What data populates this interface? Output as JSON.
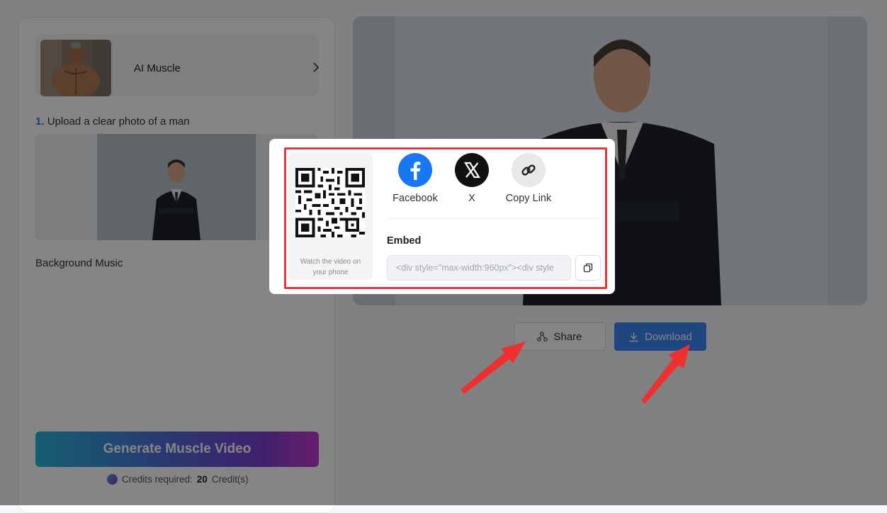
{
  "template": {
    "name": "AI Muscle"
  },
  "upload": {
    "step_number": "1.",
    "step_text": "Upload a clear photo of a man"
  },
  "music": {
    "label": "Background Music"
  },
  "generate": {
    "label": "Generate Muscle Video"
  },
  "credits": {
    "prefix": "Credits required:",
    "amount": "20",
    "unit": "Credit(s)"
  },
  "actions": {
    "share_label": "Share",
    "download_label": "Download"
  },
  "share_modal": {
    "qr_caption": "Watch the video on your phone",
    "options": [
      {
        "label": "Facebook",
        "icon": "facebook-icon",
        "color": "#1877f2"
      },
      {
        "label": "X",
        "icon": "x-icon",
        "color": "#111111"
      },
      {
        "label": "Copy Link",
        "icon": "link-icon",
        "color": "#e8e8ea"
      }
    ],
    "embed_title": "Embed",
    "embed_code": "<div style=\"max-width:960px\"><div style"
  },
  "colors": {
    "accent": "#3d86f5",
    "highlight": "#e5363b",
    "annotation_arrow": "#f0302f"
  }
}
